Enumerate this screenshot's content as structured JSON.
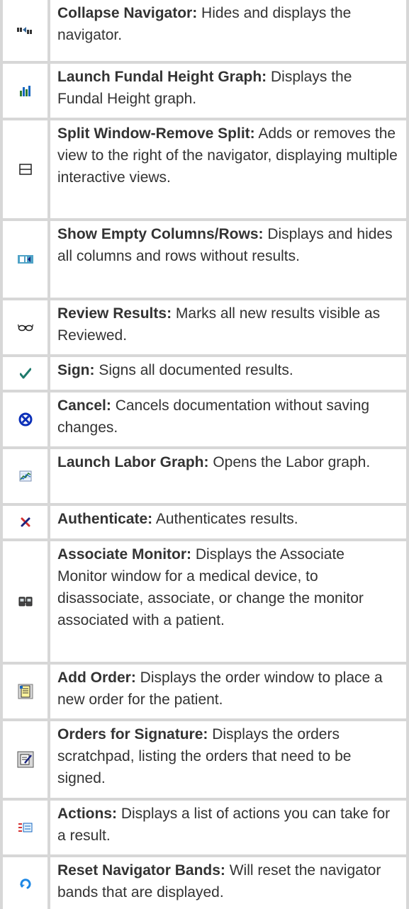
{
  "rows": [
    {
      "icon": "collapse-navigator-icon",
      "title": "Collapse Navigator:",
      "desc": " Hides and displays the navigator."
    },
    {
      "icon": "fundal-height-graph-icon",
      "title": "Launch Fundal Height Graph:",
      "desc": " Displays the Fundal Height graph."
    },
    {
      "icon": "split-window-icon",
      "title": "Split Window-Remove Split:",
      "desc": " Adds or removes the view to the right of the navigator, displaying multiple interactive views."
    },
    {
      "icon": "show-empty-columns-icon",
      "title": "Show Empty Columns/Rows:",
      "desc": " Displays and hides all columns and rows without results."
    },
    {
      "icon": "review-results-glasses-icon",
      "title": "Review Results:",
      "desc": " Marks all new results visible as Reviewed."
    },
    {
      "icon": "sign-checkmark-icon",
      "title": "Sign:",
      "desc": " Signs all documented results."
    },
    {
      "icon": "cancel-circle-x-icon",
      "title": "Cancel:",
      "desc": " Cancels documentation without saving changes."
    },
    {
      "icon": "labor-graph-icon",
      "title": "Launch Labor Graph:",
      "desc": " Opens the Labor graph."
    },
    {
      "icon": "authenticate-x-icon",
      "title": "Authenticate:",
      "desc": " Authenticates results."
    },
    {
      "icon": "associate-monitor-icon",
      "title": "Associate Monitor:",
      "desc": " Displays the Associate Monitor window for a medical device, to disassociate, associate, or change the monitor associated with a patient."
    },
    {
      "icon": "add-order-icon",
      "title": "Add Order:",
      "desc": " Displays the order window to place a new order for the patient."
    },
    {
      "icon": "orders-for-signature-icon",
      "title": "Orders for Signature:",
      "desc": " Displays the orders scratchpad, listing the orders that need to be signed."
    },
    {
      "icon": "actions-list-icon",
      "title": "Actions:",
      "desc": " Displays a list of actions you can take for a result."
    },
    {
      "icon": "reset-navigator-bands-icon",
      "title": "Reset Navigator Bands:",
      "desc": " Will reset the navigator bands that are displayed."
    }
  ]
}
